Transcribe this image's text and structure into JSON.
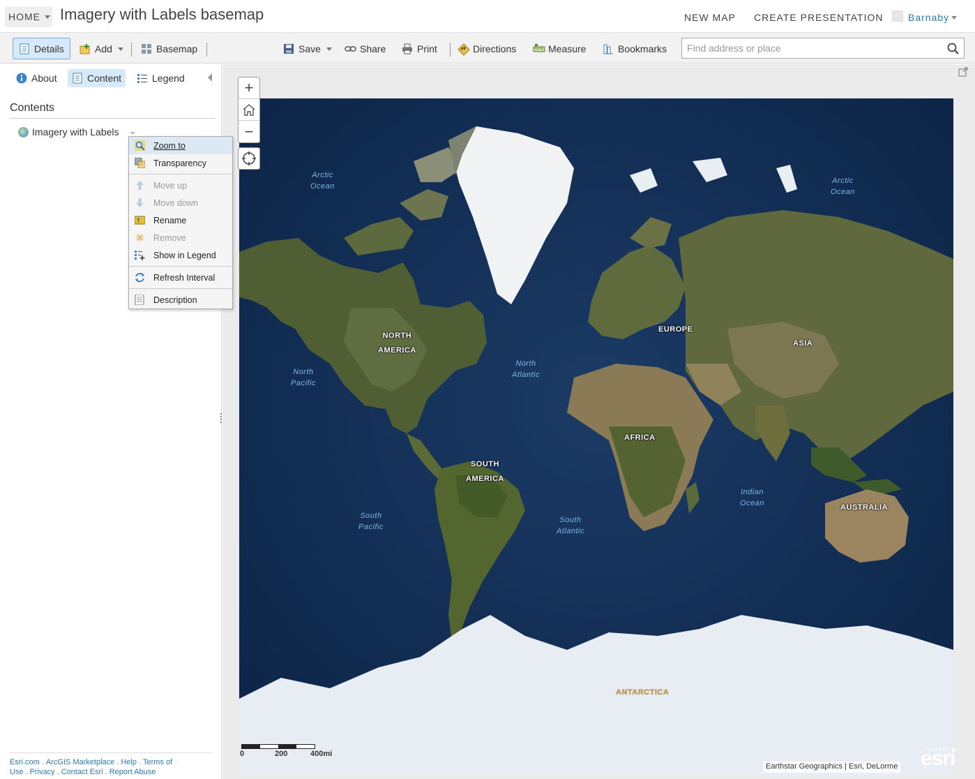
{
  "header": {
    "home_label": "HOME",
    "title": "Imagery with Labels basemap",
    "new_map": "NEW MAP",
    "create_presentation": "CREATE PRESENTATION",
    "user_name": "Barnaby"
  },
  "toolbar": {
    "details": "Details",
    "add": "Add",
    "basemap": "Basemap",
    "save": "Save",
    "share": "Share",
    "print": "Print",
    "directions": "Directions",
    "measure": "Measure",
    "bookmarks": "Bookmarks",
    "search_placeholder": "Find address or place"
  },
  "panel": {
    "tabs": {
      "about": "About",
      "content": "Content",
      "legend": "Legend"
    },
    "contents_title": "Contents",
    "layer_name": "Imagery with Labels"
  },
  "context_menu": {
    "items": [
      {
        "label": "Zoom to",
        "icon": "zoom-to-icon"
      },
      {
        "label": "Transparency",
        "icon": "transparency-icon"
      },
      {
        "label": "Move up",
        "icon": "arrow-up-icon"
      },
      {
        "label": "Move down",
        "icon": "arrow-down-icon"
      },
      {
        "label": "Rename",
        "icon": "rename-icon"
      },
      {
        "label": "Remove",
        "icon": "remove-icon"
      },
      {
        "label": "Show in Legend",
        "icon": "legend-add-icon"
      },
      {
        "label": "Refresh Interval",
        "icon": "refresh-icon"
      },
      {
        "label": "Description",
        "icon": "document-icon"
      }
    ]
  },
  "footer": {
    "esri": "Esri.com",
    "marketplace": "ArcGIS Marketplace",
    "help": "Help",
    "terms": "Terms of Use",
    "privacy": "Privacy",
    "contact": "Contact Esri",
    "report": "Report Abuse"
  },
  "map": {
    "continents": {
      "north_america": [
        "NORTH",
        "AMERICA"
      ],
      "south_america": [
        "SOUTH",
        "AMERICA"
      ],
      "europe": "EUROPE",
      "asia": "ASIA",
      "africa": "AFRICA",
      "australia": "AUSTRALIA",
      "antarctica": "ANTARCTICA"
    },
    "oceans": {
      "arctic_w": [
        "Arctic",
        "Ocean"
      ],
      "arctic_e": [
        "Arctic",
        "Ocean"
      ],
      "north_pacific": [
        "North",
        "Pacific"
      ],
      "north_atlantic": [
        "North",
        "Atlantic"
      ],
      "south_pacific": [
        "South",
        "Pacific"
      ],
      "south_atlantic": [
        "South",
        "Atlantic"
      ],
      "indian": [
        "Indian",
        "Ocean"
      ]
    },
    "scale": {
      "zero": "0",
      "mid": "200",
      "max": "400mi"
    },
    "attribution": "Earthstar Geographics | Esri, DeLorme",
    "logo_powered": "POWERED BY",
    "logo_text": "esri"
  },
  "colors": {
    "accent": "#2a7ab0",
    "active_tab": "#d6e9f8",
    "ocean": "#0e2a50",
    "ice": "#e8ecf3",
    "land": "#5d6b3c"
  }
}
